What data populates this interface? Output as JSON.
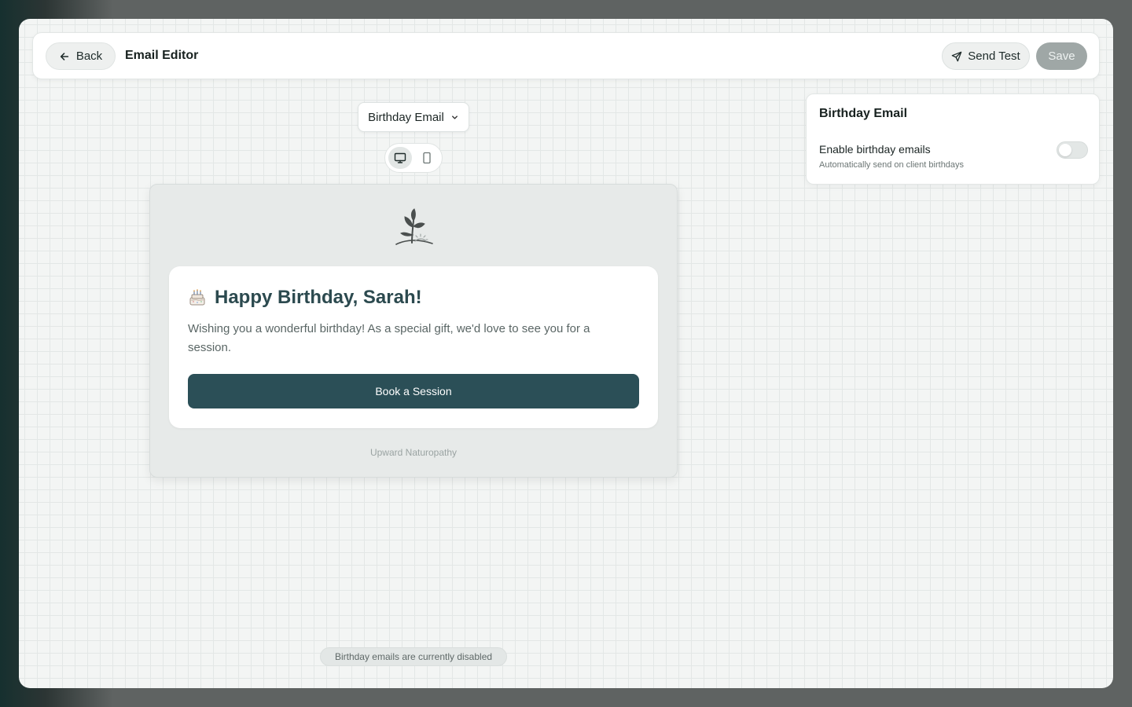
{
  "header": {
    "back_label": "Back",
    "title": "Email Editor",
    "send_test_label": "Send Test",
    "save_label": "Save"
  },
  "editor": {
    "template_selected": "Birthday Email",
    "view_modes": [
      "desktop",
      "mobile"
    ],
    "active_view": "desktop"
  },
  "email": {
    "logo_icon": "sprout-logo-icon",
    "emoji": "birthday-cake-icon",
    "heading": "Happy Birthday, Sarah!",
    "body": "Wishing you a wonderful birthday! As a special gift, we'd love to see you for a session.",
    "cta_label": "Book a Session",
    "footer": "Upward Naturopathy"
  },
  "settings_panel": {
    "title": "Birthday Email",
    "toggle_label": "Enable birthday emails",
    "toggle_description": "Automatically send on client birthdays",
    "toggle_enabled": false
  },
  "status": {
    "message": "Birthday emails are currently disabled"
  },
  "colors": {
    "accent": "#2b4f57",
    "heading": "#2c4a4f",
    "save_disabled": "#9fa7a6"
  }
}
